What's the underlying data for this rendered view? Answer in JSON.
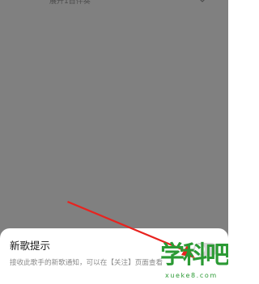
{
  "header": {
    "expand_label": "展开1首伴奏",
    "expand_icon": "chevron-down-icon"
  },
  "sheet": {
    "title": "新歌提示",
    "description": "接收此歌手的新歌通知，可以在【关注】页面查看",
    "toggle": {
      "state": "off"
    }
  },
  "watermark": {
    "logo_text": "学科吧",
    "domain": "xueke8.com"
  },
  "colors": {
    "overlay": "#808080",
    "sheet_bg": "#ffffff",
    "annotation_arrow": "#e8231f",
    "watermark": "#2b9a34"
  }
}
